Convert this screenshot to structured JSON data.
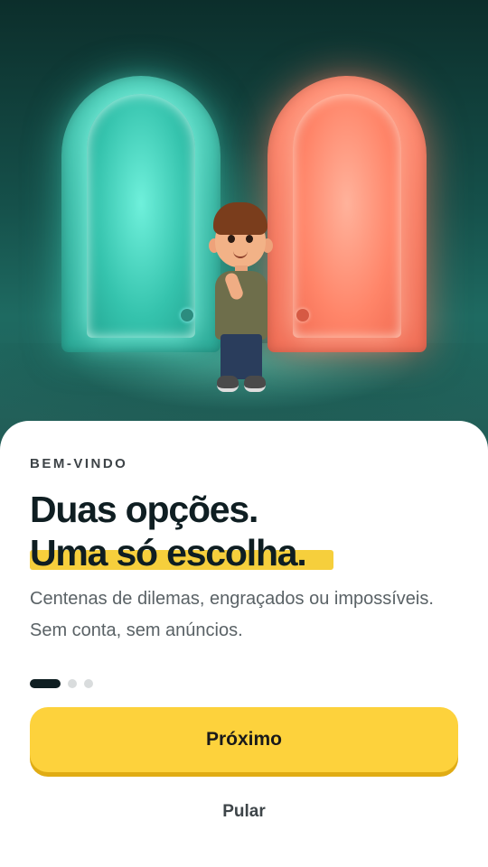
{
  "hero": {
    "illustration": "boy-between-two-glowing-doors"
  },
  "onboarding": {
    "eyebrow": "BEM-VINDO",
    "title_line1": "Duas opções.",
    "title_line2": "Uma só escolha.",
    "subtitle": "Centenas de dilemas, engraçados ou impossíveis. Sem conta, sem anúncios.",
    "pagination": {
      "total": 3,
      "current": 1
    },
    "next_label": "Próximo",
    "skip_label": "Pular"
  },
  "colors": {
    "accent": "#fdd23c",
    "door_left": "#49c9b4",
    "door_right": "#ff8a70",
    "text_primary": "#0f1e22"
  }
}
